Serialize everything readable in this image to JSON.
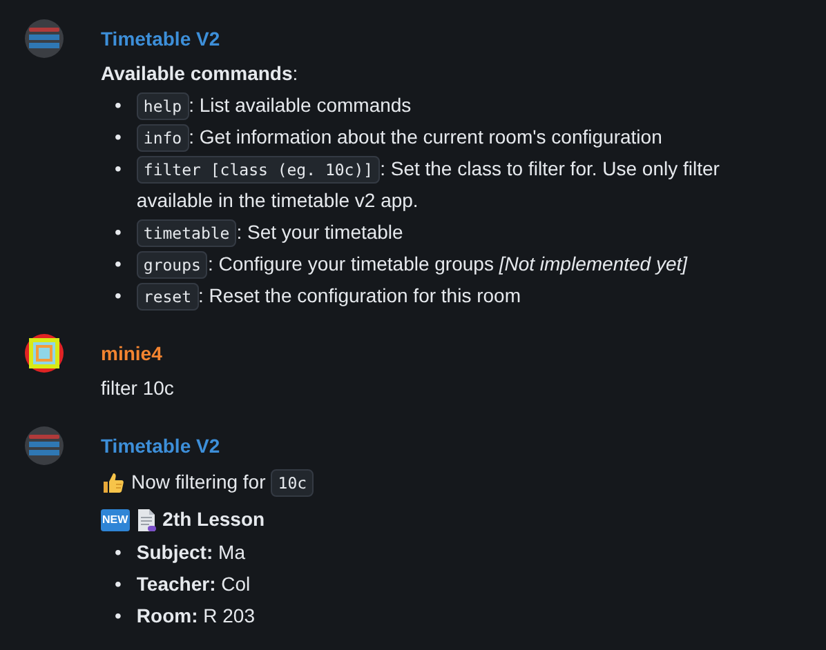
{
  "messages": [
    {
      "kind": "commands",
      "bot": true,
      "sender": "Timetable V2",
      "color": "#3d8fd9",
      "heading": "**Available commands**:",
      "commands": [
        {
          "bullet": "•",
          "command": "help",
          "description": ": List available commands"
        },
        {
          "bullet": "•",
          "command": "info",
          "description": ": Get information about the current room's configuration"
        },
        {
          "bullet": "•",
          "command": "filter [class (eg. 10c)]",
          "description": ": Set the class to filter for. Use only filter available in the timetable v2 app."
        },
        {
          "bullet": "•",
          "command": "timetable",
          "description": ": Set your timetable"
        },
        {
          "bullet": "•",
          "command": "groups",
          "description": ": Configure your timetable groups *[Not implemented yet]*"
        },
        {
          "bullet": "•",
          "command": "reset",
          "description": ": Reset the configuration for this room"
        }
      ]
    },
    {
      "kind": "text",
      "bot": false,
      "sender": "minie4",
      "color": "#f38430",
      "text": "filter 10c"
    },
    {
      "kind": "lesson",
      "bot": true,
      "sender": "Timetable V2",
      "color": "#3d8fd9",
      "status": "Now filtering for",
      "status_code": "10c",
      "badge": "NEW",
      "title": "2th Lesson",
      "fields": [
        {
          "bullet": "•",
          "text": "**Subject:** Ma"
        },
        {
          "bullet": "•",
          "text": "**Teacher:** Col"
        },
        {
          "bullet": "•",
          "text": "**Room:** R 203"
        }
      ]
    }
  ]
}
